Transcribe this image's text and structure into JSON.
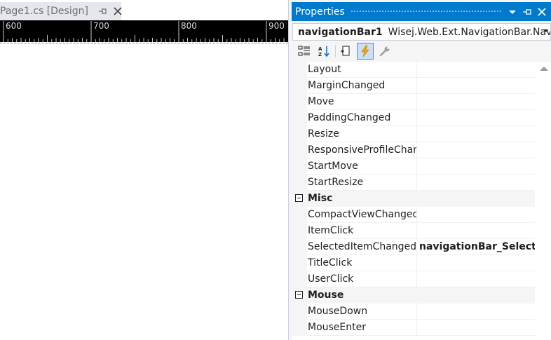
{
  "document_tab": {
    "title": "Page1.cs [Design]",
    "pin_icon": "pin-icon",
    "close_icon": "close-icon"
  },
  "ruler": {
    "labels": [
      "600",
      "700",
      "800",
      "900"
    ]
  },
  "properties_panel": {
    "title": "Properties",
    "titlebar_icons": [
      "dropdown-arrow-icon",
      "pin-icon",
      "close-icon"
    ],
    "object_selector": {
      "name": "navigationBar1",
      "type": "Wisej.Web.Ext.NavigationBar.Navig"
    },
    "toolbar": {
      "buttons": [
        {
          "icon": "categorized-icon",
          "active": false
        },
        {
          "icon": "alphabetical-icon",
          "active": false
        },
        {
          "icon": "properties-icon",
          "active": false
        },
        {
          "icon": "events-lightning-icon",
          "active": true
        },
        {
          "icon": "property-pages-wrench-icon",
          "active": false
        }
      ]
    },
    "rows": [
      {
        "kind": "prop",
        "name": "Layout",
        "value": ""
      },
      {
        "kind": "prop",
        "name": "MarginChanged",
        "value": ""
      },
      {
        "kind": "prop",
        "name": "Move",
        "value": ""
      },
      {
        "kind": "prop",
        "name": "PaddingChanged",
        "value": ""
      },
      {
        "kind": "prop",
        "name": "Resize",
        "value": ""
      },
      {
        "kind": "prop",
        "name": "ResponsiveProfileChang",
        "value": ""
      },
      {
        "kind": "prop",
        "name": "StartMove",
        "value": ""
      },
      {
        "kind": "prop",
        "name": "StartResize",
        "value": ""
      },
      {
        "kind": "category",
        "name": "Misc"
      },
      {
        "kind": "prop",
        "name": "CompactViewChanged",
        "value": ""
      },
      {
        "kind": "prop",
        "name": "ItemClick",
        "value": ""
      },
      {
        "kind": "prop",
        "name": "SelectedItemChanged",
        "value": "navigationBar_SelectedI"
      },
      {
        "kind": "prop",
        "name": "TitleClick",
        "value": ""
      },
      {
        "kind": "prop",
        "name": "UserClick",
        "value": ""
      },
      {
        "kind": "category",
        "name": "Mouse"
      },
      {
        "kind": "prop",
        "name": "MouseDown",
        "value": ""
      },
      {
        "kind": "prop",
        "name": "MouseEnter",
        "value": ""
      }
    ],
    "accent_color": "#007acc"
  }
}
